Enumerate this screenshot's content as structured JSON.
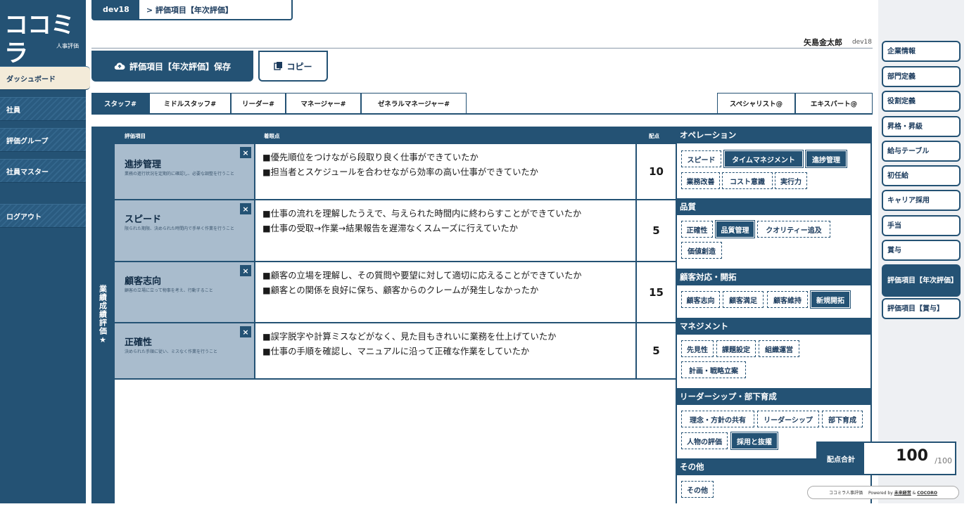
{
  "logo": {
    "mark": "ココミラ",
    "subtitle": "人事評価"
  },
  "sidebar": {
    "items": [
      {
        "label": "ダッシュボード",
        "active": true
      },
      {
        "label": "社員"
      },
      {
        "label": "評価グループ"
      },
      {
        "label": "社員マスター"
      },
      {
        "label": "ログアウト"
      }
    ]
  },
  "header": {
    "env": "dev18",
    "breadcrumb": "> 評価項目【年次評価】",
    "user_name": "矢島金太郎",
    "user_env": "dev18"
  },
  "toolbar": {
    "save_label": "評価項目【年次評価】保存",
    "copy_label": "コピー"
  },
  "level_tabs": [
    {
      "label": "スタッフ#",
      "active": true
    },
    {
      "label": "ミドルスタッフ#"
    },
    {
      "label": "リーダー#"
    },
    {
      "label": "マネージャー#"
    },
    {
      "label": "ゼネラルマネージャー#"
    },
    {
      "label": "スペシャリスト@"
    },
    {
      "label": "エキスパート@"
    }
  ],
  "table": {
    "section_label": "業績成績評価★",
    "headers": {
      "item": "評価項目",
      "point": "着眼点",
      "score": "配点"
    },
    "rows": [
      {
        "title": "進捗管理",
        "desc": "業務の進行状況を定期的に確認し、必要な調整を行うこと",
        "points": [
          "■優先順位をつけながら段取り良く仕事ができていたか",
          "■担当者とスケジュールを合わせながら効率の高い仕事ができていたか"
        ],
        "score": "10"
      },
      {
        "title": "スピード",
        "desc": "限られた期限、決められた時間内で手早く作業を行うこと",
        "points": [
          "■仕事の流れを理解したうえで、与えられた時間内に終わらすことができていたか",
          "■仕事の受取→作業→結果報告を遅滞なくスムーズに行えていたか"
        ],
        "score": "5"
      },
      {
        "title": "顧客志向",
        "desc": "顧客の立場に立って物事を考え、行動すること",
        "points": [
          "■顧客の立場を理解し、その質問や要望に対して適切に応えることができていたか",
          "■顧客との関係を良好に保ち、顧客からのクレームが発生しなかったか"
        ],
        "score": "15"
      },
      {
        "title": "正確性",
        "desc": "決められた手順に従い、ミスなく作業を行うこと",
        "points": [
          "■誤字脱字や計算ミスなどがなく、見た目もきれいに業務を仕上げていたか",
          "■仕事の手順を確認し、マニュアルに沿って正確な作業をしていたか"
        ],
        "score": "5"
      }
    ]
  },
  "categories": [
    {
      "name": "オペレーション",
      "tags": [
        {
          "label": "スピード"
        },
        {
          "label": "タイムマネジメント",
          "selected": true
        },
        {
          "label": "進捗管理",
          "selected": true
        },
        {
          "label": "業務改善"
        },
        {
          "label": "コスト意識"
        },
        {
          "label": "実行力"
        }
      ]
    },
    {
      "name": "品質",
      "tags": [
        {
          "label": "正確性"
        },
        {
          "label": "品質管理",
          "selected": true
        },
        {
          "label": "クオリティー追及"
        },
        {
          "label": "価値創造"
        }
      ]
    },
    {
      "name": "顧客対応・開拓",
      "tags": [
        {
          "label": "顧客志向"
        },
        {
          "label": "顧客満足"
        },
        {
          "label": "顧客維持"
        },
        {
          "label": "新規開拓",
          "selected": true
        }
      ]
    },
    {
      "name": "マネジメント",
      "tags": [
        {
          "label": "先見性"
        },
        {
          "label": "課題設定"
        },
        {
          "label": "組織運営"
        },
        {
          "label": "計画・戦略立案"
        }
      ]
    },
    {
      "name": "リーダーシップ・部下育成",
      "tags": [
        {
          "label": "理念・方針の共有"
        },
        {
          "label": "リーダーシップ"
        },
        {
          "label": "部下育成"
        },
        {
          "label": "人物の評価"
        },
        {
          "label": "採用と抜擢",
          "selected": true
        }
      ]
    },
    {
      "name": "その他",
      "tags": [
        {
          "label": "その他"
        }
      ]
    }
  ],
  "right_nav": [
    {
      "label": "企業情報"
    },
    {
      "label": "部門定義"
    },
    {
      "label": "役割定義"
    },
    {
      "label": "昇格・昇級"
    },
    {
      "label": "給与テーブル"
    },
    {
      "label": "初任給"
    },
    {
      "label": "キャリア採用"
    },
    {
      "label": "手当"
    },
    {
      "label": "賞与"
    },
    {
      "label": "評価項目【年次評価】",
      "active": true
    },
    {
      "label": "評価項目【賞与】"
    }
  ],
  "total": {
    "label": "配点合計",
    "value": "100",
    "max": "/100"
  },
  "footer": {
    "brand": "ココミラ人事評価",
    "powered": "Powered by",
    "company1": "未来経営",
    "amp": "&",
    "company2": "COCORO"
  },
  "icons": {
    "upload": "cloud-upload-icon",
    "copy": "copy-icon",
    "close": "close-icon"
  },
  "colors": {
    "navy": "#245274",
    "pale": "#a9bccd",
    "active_nav": "#f3ebd9"
  }
}
